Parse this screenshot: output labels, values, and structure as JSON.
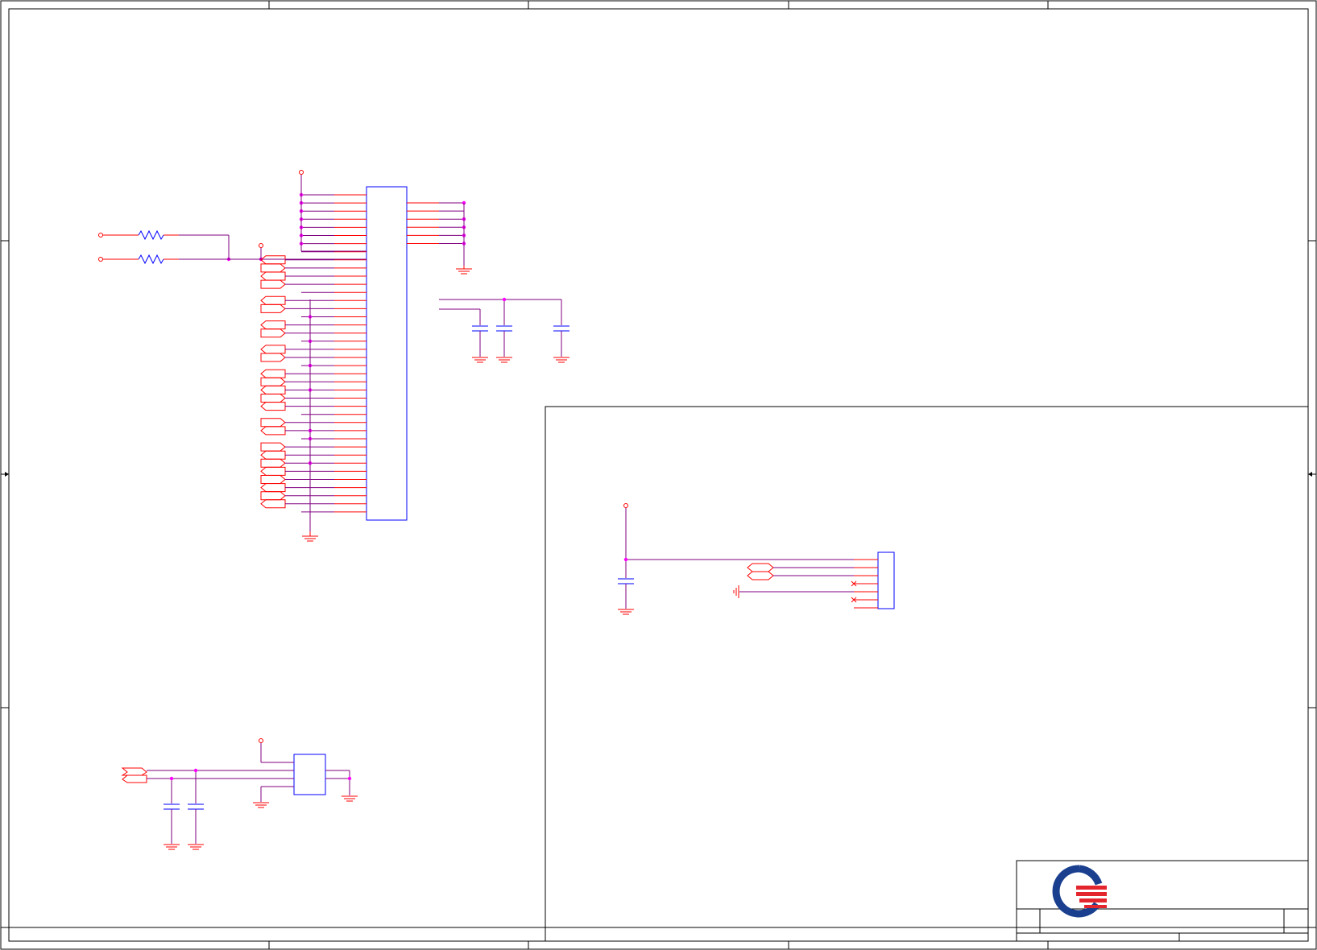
{
  "sheet": {
    "colors": {
      "border": "#000000",
      "wire": "#800080",
      "pin": "#ff0000",
      "component": "#0000ff",
      "junction": "#ff00ff",
      "logo_blue": "#1a3f8f",
      "logo_red": "#e3262e"
    },
    "title_block": {
      "logo_icon": "company-logo-icon"
    }
  },
  "connector_u1": {
    "left_pin_count": 40,
    "right_pin_count": 6
  },
  "regulator_u2": {
    "pin_count": 4
  },
  "connector_j1": {
    "pin_count": 7
  }
}
